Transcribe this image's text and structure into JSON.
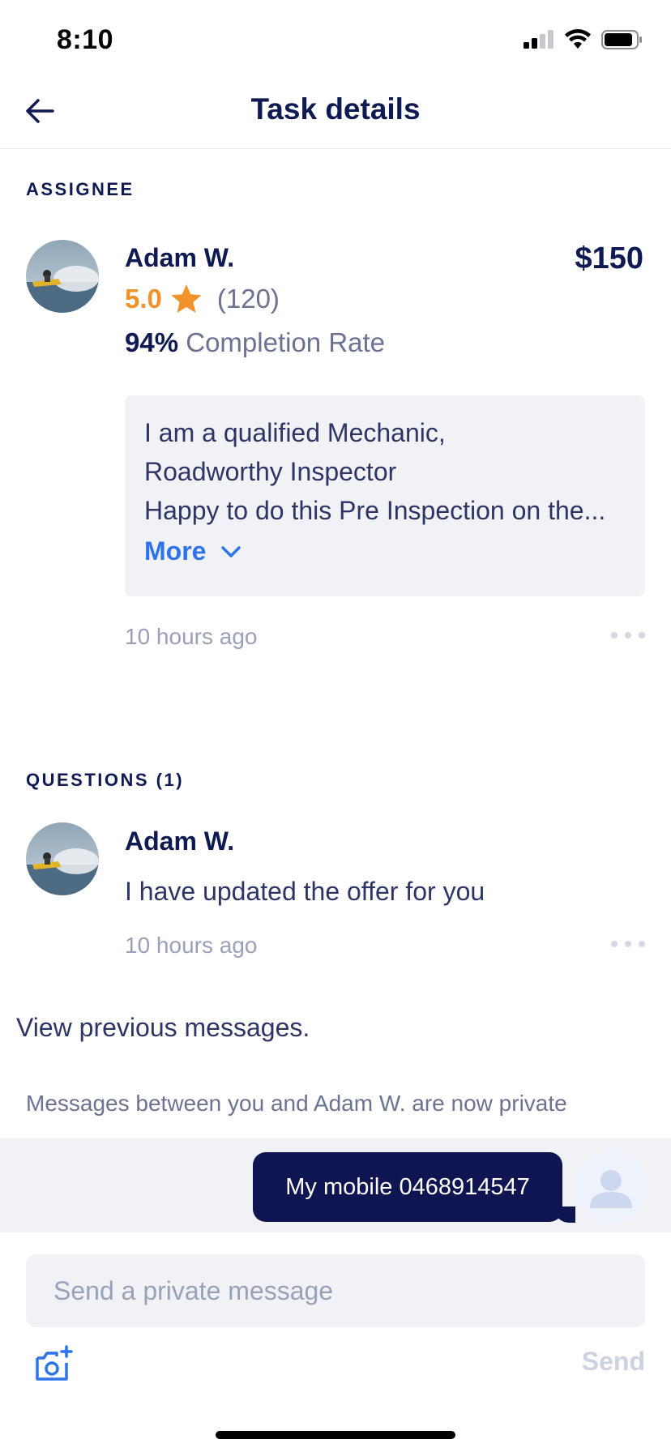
{
  "status_bar": {
    "time": "8:10"
  },
  "header": {
    "title": "Task details",
    "back_icon": "arrow-left-icon"
  },
  "assignee": {
    "section_label": "ASSIGNEE",
    "name": "Adam W.",
    "price": "$150",
    "rating": "5.0",
    "review_count": "(120)",
    "completion_percent": "94%",
    "completion_label": "Completion Rate",
    "offer_lines": [
      "I am a qualified Mechanic,",
      "Roadworthy Inspector",
      "Happy to do this Pre Inspection on the..."
    ],
    "more_label": "More",
    "timestamp": "10 hours ago"
  },
  "questions": {
    "section_label": "QUESTIONS (1)",
    "items": [
      {
        "name": "Adam W.",
        "text": "I have updated the offer for you",
        "timestamp": "10 hours ago"
      }
    ]
  },
  "view_previous_label": "View previous messages.",
  "private_note": "Messages between you and Adam W. are now private",
  "chat": {
    "message": "My mobile 0468914547"
  },
  "composer": {
    "placeholder": "Send a private message",
    "value": "",
    "send_label": "Send"
  },
  "colors": {
    "navy": "#0e1a52",
    "accent_blue": "#2e73e8",
    "star_orange": "#f0932b",
    "bubble": "#0e1550"
  }
}
